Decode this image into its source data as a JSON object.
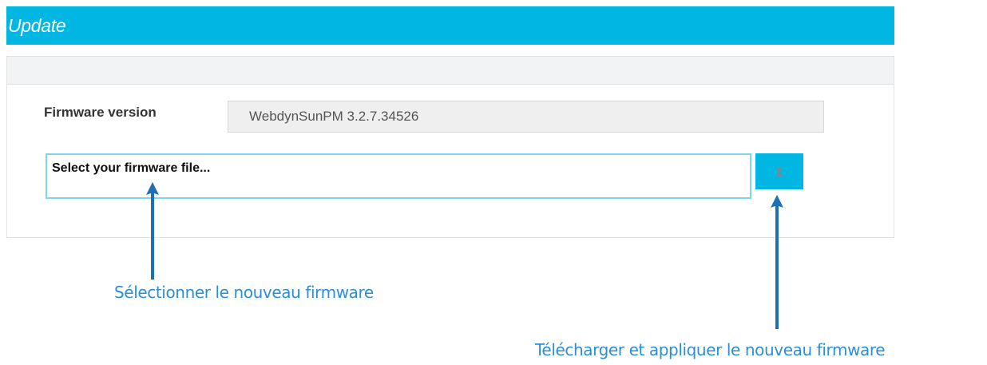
{
  "panel": {
    "title": "Update"
  },
  "firmware": {
    "label": "Firmware version",
    "value": "WebdynSunPM 3.2.7.34526"
  },
  "file_select": {
    "placeholder": "Select your firmware file..."
  },
  "upload_button": {
    "icon": "upload-icon"
  },
  "annotations": {
    "select_new_firmware": "Sélectionner le nouveau firmware",
    "upload_and_apply": "Télécharger et appliquer le nouveau firmware"
  },
  "colors": {
    "accent": "#00b6e3",
    "annotation": "#2b8fd6",
    "arrow": "#1e6fb3"
  }
}
